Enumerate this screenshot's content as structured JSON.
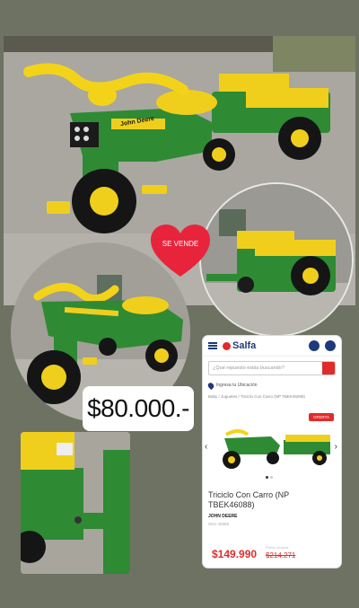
{
  "heart_label": "SE VENDE",
  "price_tag": "$80.000.-",
  "photo_brand_label": "John Deere",
  "colors": {
    "background": "#6e7263",
    "tractor_green": "#2e8b2e",
    "tractor_yellow": "#f3d31a",
    "salfa_red": "#e02b2b",
    "salfa_blue": "#1f3a7a"
  },
  "salfa": {
    "logo": "Salfa",
    "search_placeholder": "¿Qué repuesto estás buscando?",
    "location": "Ingresa tu Ubicación",
    "breadcrumb": "Baby  /  Juguetes  /  Triciclo Con Carro (NP TBEK46088)",
    "badge": "OFERTA",
    "product_title": "Triciclo Con Carro (NP TBEK46088)",
    "brand": "JOHN DEERE",
    "sku": "SKU 42968",
    "old_price_label": "Precio Normal",
    "price": "$149.990",
    "old_price": "$214.271"
  }
}
